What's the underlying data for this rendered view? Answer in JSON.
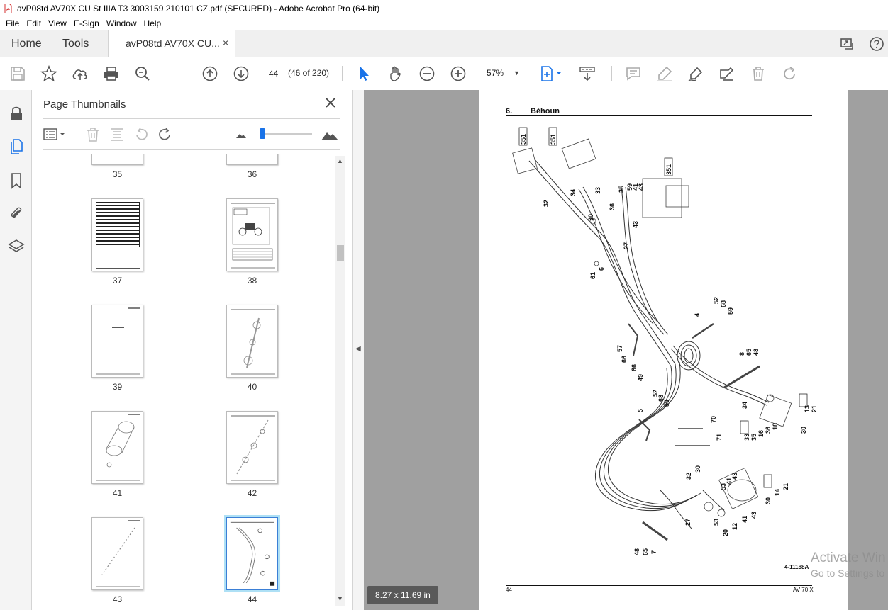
{
  "window": {
    "title": "avP08td AV70X CU St IIIA T3 3003159 210101 CZ.pdf (SECURED) - Adobe Acrobat Pro (64-bit)"
  },
  "menu": [
    "File",
    "Edit",
    "View",
    "E-Sign",
    "Window",
    "Help"
  ],
  "tabs": {
    "home": "Home",
    "tools": "Tools",
    "document": "avP08td AV70X CU...",
    "close": "×"
  },
  "toolbar": {
    "page_number": "44",
    "page_count": "(46 of 220)",
    "zoom": "57%"
  },
  "thumbnail_panel": {
    "title": "Page Thumbnails",
    "thumbnails": [
      {
        "label": "35"
      },
      {
        "label": "36"
      },
      {
        "label": "37"
      },
      {
        "label": "38"
      },
      {
        "label": "39"
      },
      {
        "label": "40"
      },
      {
        "label": "41"
      },
      {
        "label": "42"
      },
      {
        "label": "43"
      },
      {
        "label": "44",
        "selected": true
      }
    ]
  },
  "document": {
    "section_number": "6.",
    "section_title": "Běhoun",
    "drawing_code": "4-11188A",
    "page_number": "44",
    "model": "AV 70 X",
    "page_size": "8.27 x 11.69 in",
    "callouts": [
      "351",
      "351",
      "351",
      "32",
      "34",
      "33",
      "30",
      "36",
      "35",
      "59",
      "41",
      "43",
      "43",
      "27",
      "6",
      "61",
      "52",
      "68",
      "59",
      "4",
      "8",
      "65",
      "48",
      "57",
      "66",
      "66",
      "49",
      "34",
      "13",
      "21",
      "33",
      "35",
      "16",
      "36",
      "18",
      "30",
      "5",
      "52",
      "68",
      "59",
      "70",
      "71",
      "32",
      "30",
      "53",
      "41",
      "43",
      "30",
      "14",
      "21",
      "27",
      "53",
      "12",
      "41",
      "43",
      "20",
      "48",
      "65",
      "7"
    ]
  },
  "overlay": {
    "watermark_line1": "Activate Win",
    "watermark_line2": "Go to Settings to"
  },
  "colors": {
    "accent": "#1a73e8",
    "pdf_red": "#d32f2f",
    "doc_background": "#a0a0a0",
    "thumb_selected": "#aee0f5"
  }
}
